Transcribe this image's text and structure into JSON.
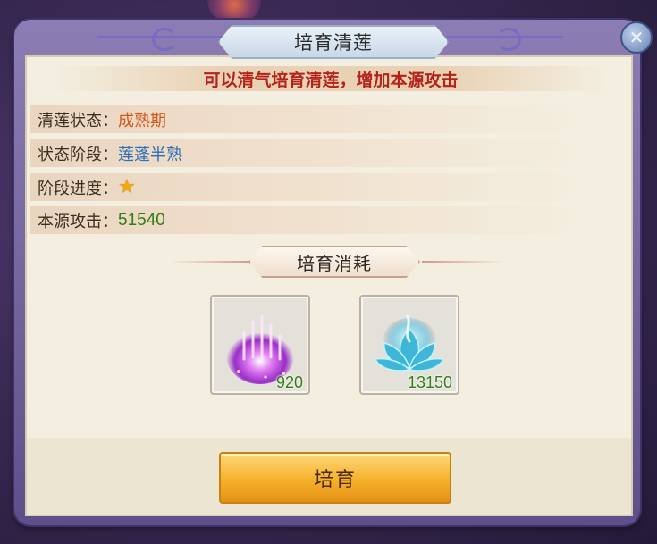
{
  "dialog": {
    "title": "培育清莲",
    "close_icon": "close-x-icon",
    "subtitle": "可以清气培育清莲，增加本源攻击"
  },
  "info": [
    {
      "label": "清莲状态：",
      "value": "成熟期"
    },
    {
      "label": "状态阶段：",
      "value": "莲蓬半熟"
    },
    {
      "label": "阶段进度：",
      "stars": 1
    },
    {
      "label": "本源攻击：",
      "value": "51540"
    }
  ],
  "cost": {
    "title": "培育消耗",
    "items": [
      {
        "icon": "purple-qi-essence-icon",
        "quantity": "920"
      },
      {
        "icon": "blue-lotus-icon",
        "quantity": "13150"
      }
    ]
  },
  "cultivate_button": {
    "label": "培育"
  },
  "colors": {
    "subtitle": "#b4231a",
    "state_value": "#d2571b",
    "stage_value": "#2a6fb8",
    "attack_value": "#2f7d14",
    "button": "#f5b12a"
  }
}
